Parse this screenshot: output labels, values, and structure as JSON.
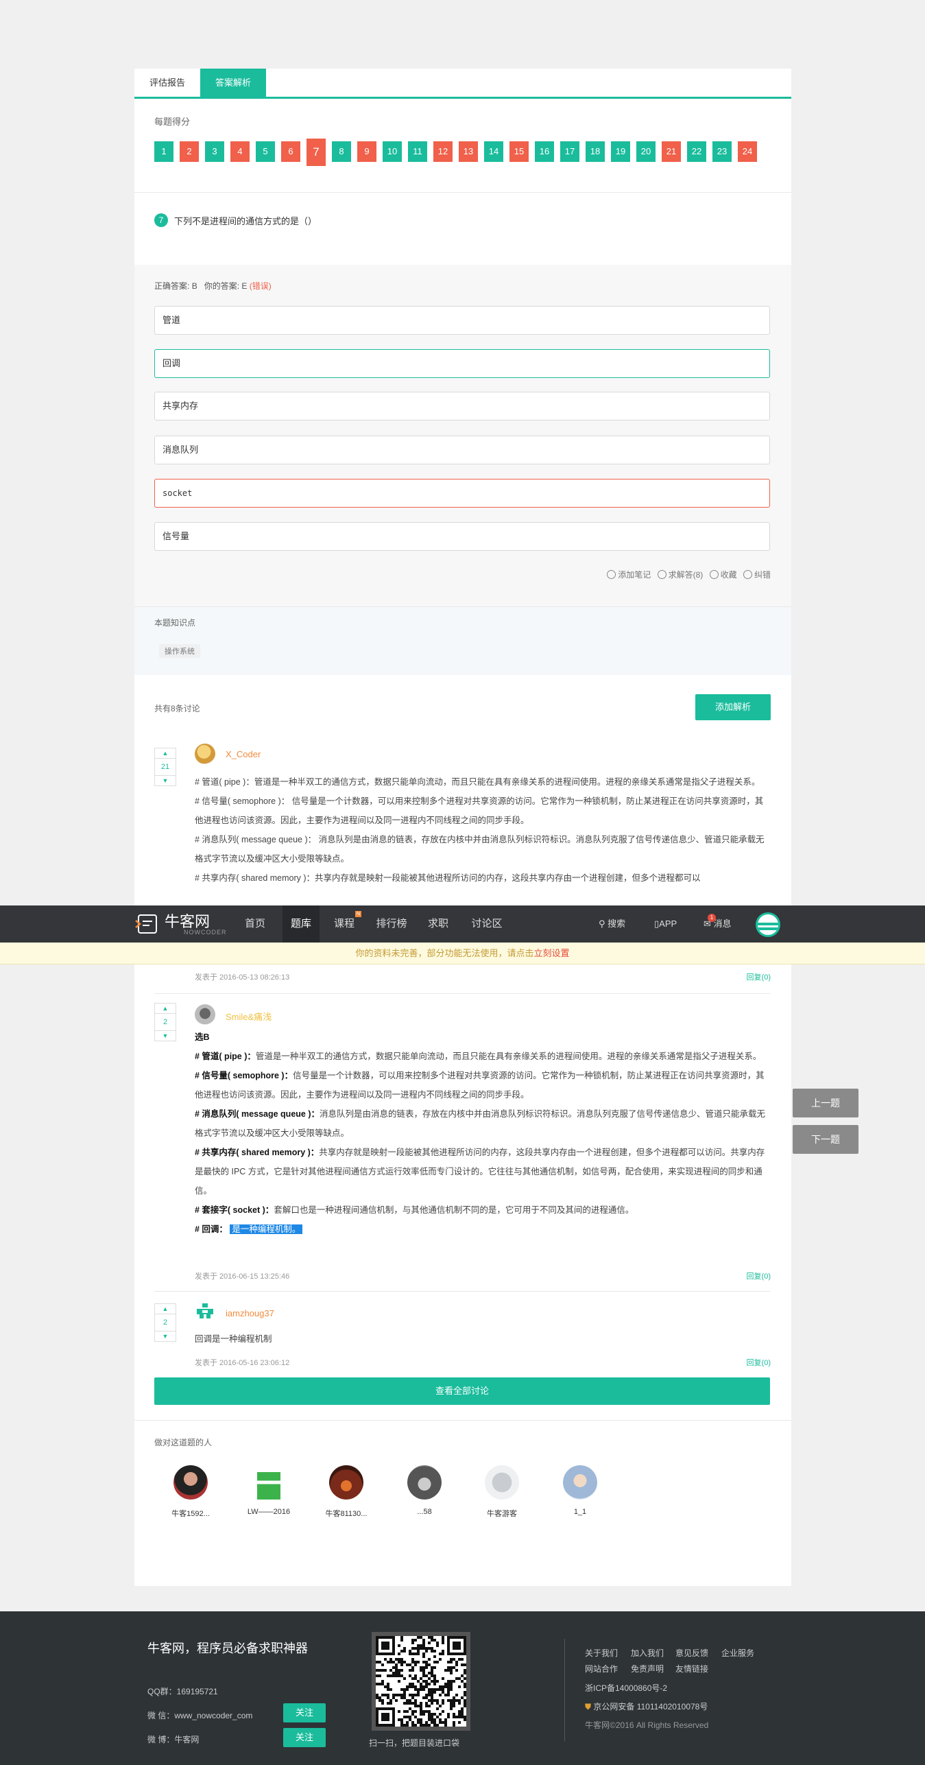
{
  "tabs": [
    "评估报告",
    "答案解析"
  ],
  "score": {
    "title": "每题得分",
    "items": [
      {
        "n": "1",
        "s": "ok"
      },
      {
        "n": "2",
        "s": "bad"
      },
      {
        "n": "3",
        "s": "ok"
      },
      {
        "n": "4",
        "s": "bad"
      },
      {
        "n": "5",
        "s": "ok"
      },
      {
        "n": "6",
        "s": "bad"
      },
      {
        "n": "7",
        "s": "cur"
      },
      {
        "n": "8",
        "s": "ok"
      },
      {
        "n": "9",
        "s": "bad"
      },
      {
        "n": "10",
        "s": "ok"
      },
      {
        "n": "11",
        "s": "ok"
      },
      {
        "n": "12",
        "s": "bad"
      },
      {
        "n": "13",
        "s": "bad"
      },
      {
        "n": "14",
        "s": "ok"
      },
      {
        "n": "15",
        "s": "bad"
      },
      {
        "n": "16",
        "s": "ok"
      },
      {
        "n": "17",
        "s": "ok"
      },
      {
        "n": "18",
        "s": "ok"
      },
      {
        "n": "19",
        "s": "ok"
      },
      {
        "n": "20",
        "s": "ok"
      },
      {
        "n": "21",
        "s": "bad"
      },
      {
        "n": "22",
        "s": "ok"
      },
      {
        "n": "23",
        "s": "ok"
      },
      {
        "n": "24",
        "s": "bad"
      }
    ]
  },
  "question": {
    "num": "7",
    "text": "下列不是进程间的通信方式的是（）"
  },
  "answer": {
    "correct_label": "正确答案:",
    "correct": "B",
    "yours_label": "你的答案:",
    "yours": "E",
    "wrong_tag": "(错误)"
  },
  "options": [
    "管道",
    "回调",
    "共享内存",
    "消息队列",
    "socket",
    "信号量"
  ],
  "tools": [
    "添加笔记",
    "求解答(8)",
    "收藏",
    "纠错"
  ],
  "knowledge": {
    "title": "本题知识点",
    "tag": "操作系统"
  },
  "discuss": {
    "count_text": "共有8条讨论",
    "add_button": "添加解析",
    "view_all": "查看全部讨论"
  },
  "comments": [
    {
      "votes": "21",
      "user": "X_Coder",
      "paras": [
        "# 管道( pipe )：管道是一种半双工的通信方式，数据只能单向流动，而且只能在具有亲缘关系的进程间使用。进程的亲缘关系通常是指父子进程关系。",
        "# 信号量( semophore )： 信号量是一个计数器，可以用来控制多个进程对共享资源的访问。它常作为一种锁机制，防止某进程正在访问共享资源时，其他进程也访问该资源。因此，主要作为进程间以及同一进程内不同线程之间的同步手段。",
        "# 消息队列( message queue )： 消息队列是由消息的链表，存放在内核中并由消息队列标识符标识。消息队列克服了信号传递信息少、管道只能承载无格式字节流以及缓冲区大小受限等缺点。",
        "# 共享内存( shared memory )：共享内存就是映射一段能被其他进程所访问的内存，这段共享内存由一个进程创建，但多个进程都可以"
      ],
      "date": "发表于 2016-05-13 08:26:13",
      "reply": "回复(0)"
    },
    {
      "votes": "2",
      "user": "Smile&痛浅",
      "lead": "选B",
      "items": [
        {
          "k": "# 管道( pipe )：",
          "v": "管道是一种半双工的通信方式，数据只能单向流动，而且只能在具有亲缘关系的进程间使用。进程的亲缘关系通常是指父子进程关系。"
        },
        {
          "k": "# 信号量( semophore )：",
          "v": "信号量是一个计数器，可以用来控制多个进程对共享资源的访问。它常作为一种锁机制，防止某进程正在访问共享资源时，其他进程也访问该资源。因此，主要作为进程间以及同一进程内不同线程之间的同步手段。"
        },
        {
          "k": "# 消息队列( message queue )：",
          "v": "消息队列是由消息的链表，存放在内核中并由消息队列标识符标识。消息队列克服了信号传递信息少、管道只能承载无格式字节流以及缓冲区大小受限等缺点。"
        },
        {
          "k": "# 共享内存( shared memory )：",
          "v": "共享内存就是映射一段能被其他进程所访问的内存，这段共享内存由一个进程创建，但多个进程都可以访问。共享内存是最快的 IPC 方式，它是针对其他进程间通信方式运行效率低而专门设计的。它往往与其他通信机制，如信号两，配合使用，来实现进程间的同步和通信。"
        },
        {
          "k": "# 套接字( socket )：",
          "v": "套解口也是一种进程间通信机制，与其他通信机制不同的是，它可用于不同及其间的进程通信。"
        }
      ],
      "last_k": "# 回调：",
      "last_v": "是一种编程机制。",
      "date": "发表于 2016-06-15 13:25:46",
      "reply": "回复(0)"
    },
    {
      "votes": "2",
      "user": "iamzhoug37",
      "text": "回调是一种编程机制",
      "date": "发表于 2016-05-16 23:06:12",
      "reply": "回复(0)"
    }
  ],
  "people": {
    "title": "做对这道题的人",
    "list": [
      "牛客1592...",
      "LW——2016",
      "牛客81130...",
      "...58",
      "牛客游客",
      "1_1"
    ]
  },
  "navbar": {
    "logo": "牛客网",
    "logo_sub": "NOWCODER",
    "items": [
      "首页",
      "题库",
      "课程",
      "排行榜",
      "求职",
      "讨论区"
    ],
    "active": "题库",
    "search": "搜索",
    "app": "APP",
    "msg": "消息",
    "msg_badge": "1"
  },
  "notice": {
    "text": "你的资料未完善，部分功能无法使用，请点击",
    "link": "立刻设置"
  },
  "side": {
    "prev": "上一题",
    "next": "下一题"
  },
  "footer": {
    "slogan": "牛客网，程序员必备求职神器",
    "qq": "QQ群：169195721",
    "wechat": "微 信：www_nowcoder_com",
    "weibo": "微 博：牛客网",
    "follow": "关注",
    "qr_caption": "扫一扫，把题目装进口袋",
    "links1": [
      "关于我们",
      "加入我们",
      "意见反馈",
      "企业服务"
    ],
    "links2": [
      "网站合作",
      "免责声明",
      "友情链接"
    ],
    "icp": "浙ICP备14000860号-2",
    "police": "京公网安备 11011402010078号",
    "copyright": "牛客网©2016 All Rights Reserved"
  }
}
